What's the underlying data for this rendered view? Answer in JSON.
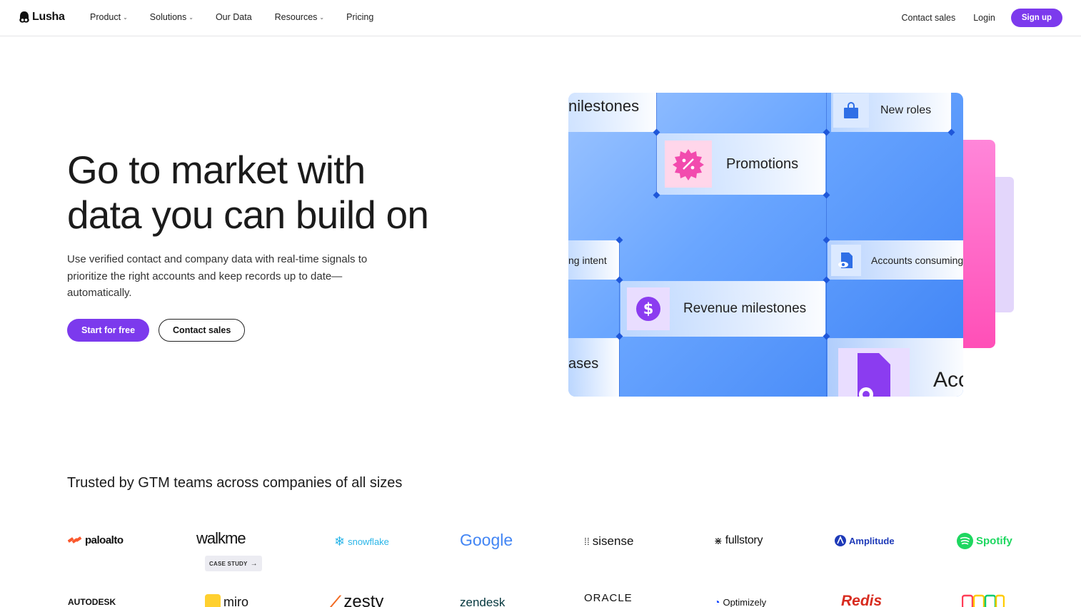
{
  "nav": {
    "logo_text": "Lusha",
    "links": [
      {
        "label": "Product",
        "dropdown": true
      },
      {
        "label": "Solutions",
        "dropdown": true
      },
      {
        "label": "Our Data",
        "dropdown": false
      },
      {
        "label": "Resources",
        "dropdown": true
      },
      {
        "label": "Pricing",
        "dropdown": false
      }
    ],
    "contact_sales": "Contact sales",
    "login": "Login",
    "signup": "Sign up"
  },
  "hero": {
    "title_line1": "Go to market with",
    "title_line2": "data you can build on",
    "subtitle": "Use verified contact and company data with real-time signals to prioritize the right accounts and keep records up to date—automatically.",
    "cta_primary": "Start for free",
    "cta_secondary": "Contact sales"
  },
  "visual": {
    "tiles": {
      "milestones": "nilestones",
      "new_roles": "New roles",
      "promotions": "Promotions",
      "intent": "ng intent",
      "accounts_consuming": "Accounts consuming",
      "revenue_milestones": "Revenue milestones",
      "ases": "ases",
      "acc": "Acc"
    }
  },
  "trusted": {
    "heading": "Trusted by GTM teams across companies of all sizes",
    "case_study": "CASE STUDY",
    "row1": [
      "paloalto",
      "walkme",
      "snowflake",
      "Google",
      "sisense",
      "fullstory",
      "Amplitude",
      "Spotify"
    ],
    "row2": [
      "AUTODESK",
      "miro",
      "zesty",
      "zendesk",
      "ORACLE",
      "Optimizely",
      "Redis",
      "monday"
    ]
  },
  "colors": {
    "accent": "#7c3aed",
    "visual_blue": "#4a8cf7",
    "pink": "#ff4fb7"
  }
}
